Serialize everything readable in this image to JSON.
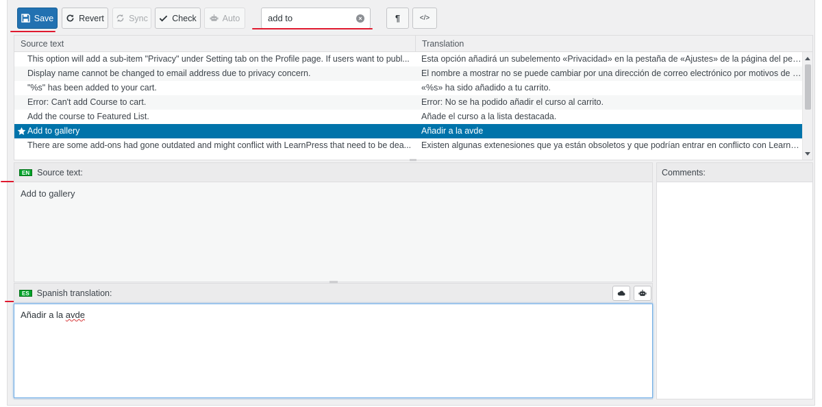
{
  "toolbar": {
    "save_label": "Save",
    "revert_label": "Revert",
    "sync_label": "Sync",
    "check_label": "Check",
    "auto_label": "Auto",
    "search_value": "add to",
    "invisibles_icon": "¶",
    "code_view_icon": "</>"
  },
  "grid": {
    "headers": {
      "source": "Source text",
      "translation": "Translation"
    },
    "rows": [
      {
        "source": "This option will add a sub-item \"Privacy\" under Setting tab on the Profile page. If users want to publ...",
        "translation": "Esta opción añadirá un subelemento «Privacidad» en la pestaña de «Ajustes» de la página del perfil. Si..."
      },
      {
        "source": "Display name cannot be changed to email address due to privacy concern.",
        "translation": "El nombre a mostrar no se puede cambiar por una dirección de correo electrónico por motivos de pri..."
      },
      {
        "source": "\"%s\" has been added to your cart.",
        "translation": "«%s» ha sido añadido a tu carrito."
      },
      {
        "source": "Error: Can't add Course to cart.",
        "translation": "Error: No se ha podido añadir el curso al carrito."
      },
      {
        "source": "Add the course to Featured List.",
        "translation": "Añade el curso a la lista destacada."
      },
      {
        "source": "Add to gallery",
        "translation": "Añadir a la avde",
        "selected": true
      },
      {
        "source": "There are some add-ons had gone outdated and might conflict with LearnPress that need to be dea...",
        "translation": "Existen algunas extenesiones que ya están obsoletos y que podrían entrar en conflicto con LearnPress..."
      }
    ]
  },
  "source_pane": {
    "lang_code": "EN",
    "title": "Source text:",
    "text": "Add to gallery"
  },
  "translation_pane": {
    "lang_code": "ES",
    "title": "Spanish translation:",
    "text_plain": "Añadir a la ",
    "text_misspelled": "avde"
  },
  "comments": {
    "title": "Comments:"
  },
  "colors": {
    "primary": "#2271b1",
    "selected_row": "#0073aa",
    "annotation_red": "#e0182d",
    "lang_flag": "#00a32a"
  }
}
